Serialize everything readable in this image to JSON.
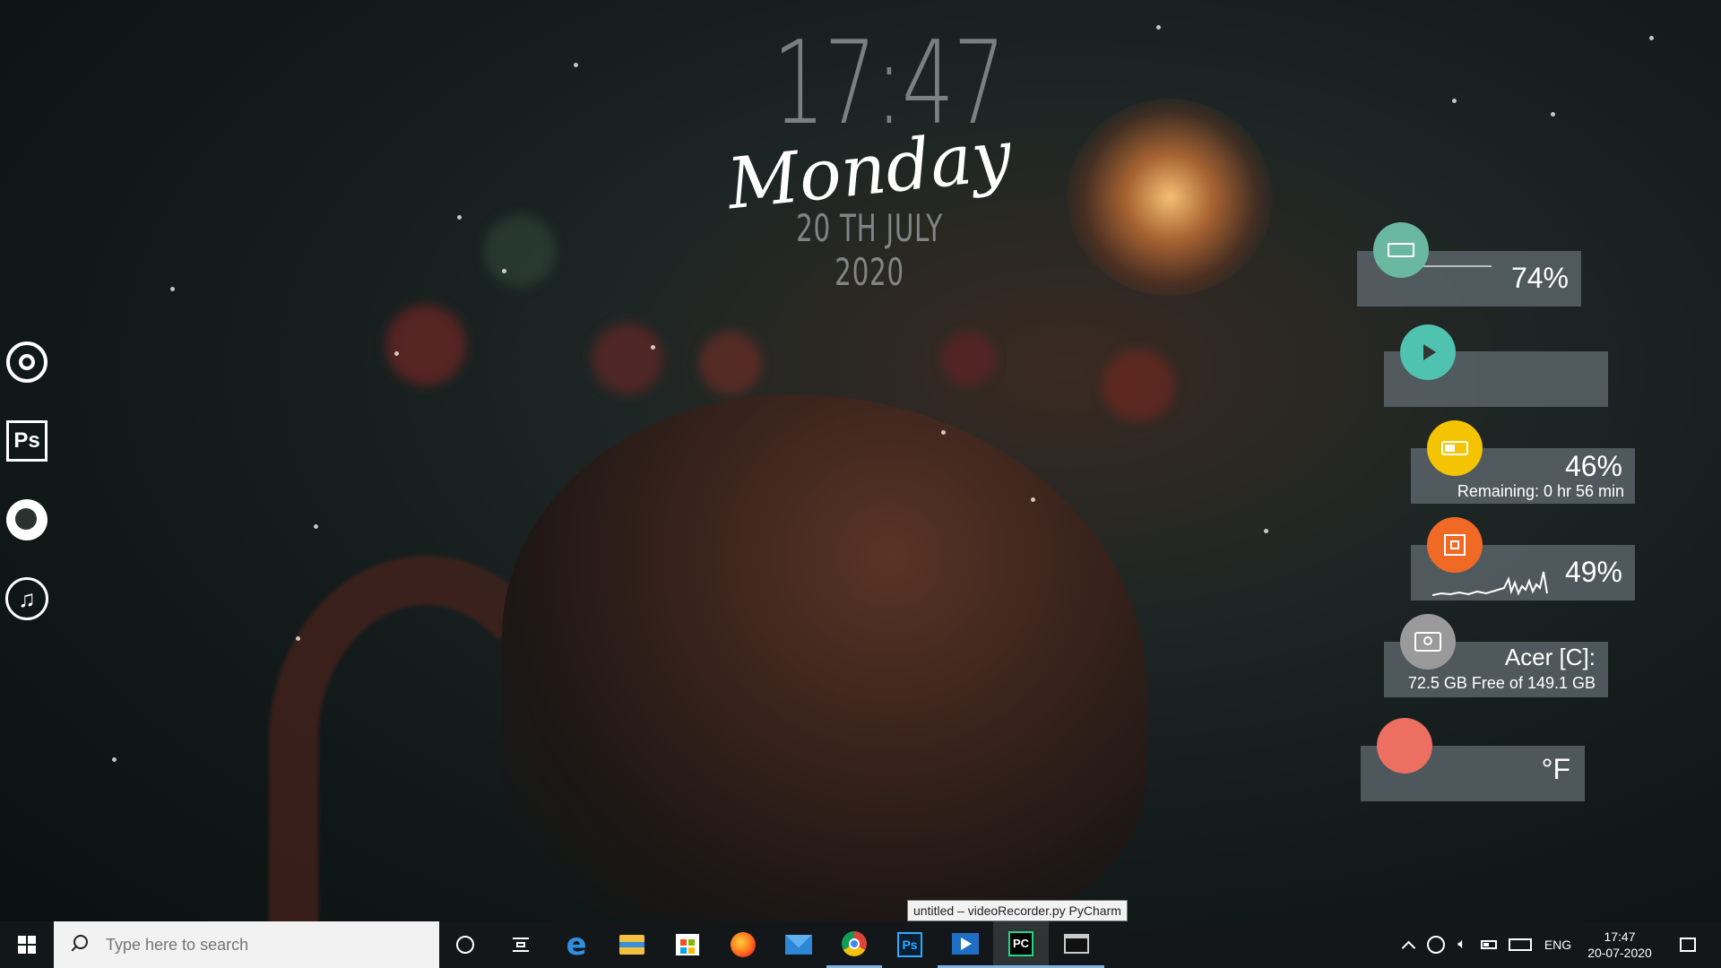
{
  "clock": {
    "time": "17:47",
    "day": "Monday",
    "date": "20 TH JULY 2020"
  },
  "dock": {
    "items": [
      {
        "name": "chrome",
        "icon": "chrome-icon"
      },
      {
        "name": "photoshop",
        "label": "Ps",
        "icon": "photoshop-icon"
      },
      {
        "name": "firefox",
        "icon": "firefox-icon"
      },
      {
        "name": "music",
        "icon": "music-note-icon"
      }
    ]
  },
  "widgets": {
    "ram": {
      "value": "74%",
      "icon": "ram-icon",
      "color": "#6ab8a0",
      "level": 0.74
    },
    "media": {
      "icon": "play-icon",
      "color": "#4fc2b0"
    },
    "battery": {
      "value": "46%",
      "remaining": "Remaining: 0 hr 56 min",
      "icon": "battery-icon",
      "color": "#f5c400",
      "level": 0.46
    },
    "cpu": {
      "value": "49%",
      "icon": "cpu-icon",
      "color": "#f06a25",
      "level": 0.49
    },
    "disk": {
      "title": "Acer [C]:",
      "detail": "72.5 GB Free of 149.1 GB",
      "icon": "hard-drive-icon",
      "color": "#9a9a9a"
    },
    "weather": {
      "unit": "°F",
      "color": "#ec6f62"
    }
  },
  "taskbar": {
    "search_placeholder": "Type here to search",
    "tooltip": "untitled – videoRecorder.py PyCharm",
    "apps": [
      {
        "name": "cortana",
        "icon": "cortana-icon"
      },
      {
        "name": "task-view",
        "icon": "task-view-icon"
      },
      {
        "name": "edge",
        "icon": "edge-icon"
      },
      {
        "name": "file-explorer",
        "icon": "folder-icon"
      },
      {
        "name": "store",
        "icon": "store-icon"
      },
      {
        "name": "firefox",
        "icon": "firefox-icon"
      },
      {
        "name": "mail",
        "icon": "mail-icon"
      },
      {
        "name": "chrome",
        "icon": "chrome-icon"
      },
      {
        "name": "photoshop",
        "label": "Ps",
        "icon": "photoshop-icon"
      },
      {
        "name": "video-player",
        "icon": "video-player-icon"
      },
      {
        "name": "pycharm",
        "label": "PC",
        "icon": "pycharm-icon"
      },
      {
        "name": "terminal",
        "icon": "terminal-icon"
      }
    ],
    "tray": {
      "language": "ENG",
      "time": "17:47",
      "date": "20-07-2020"
    }
  }
}
